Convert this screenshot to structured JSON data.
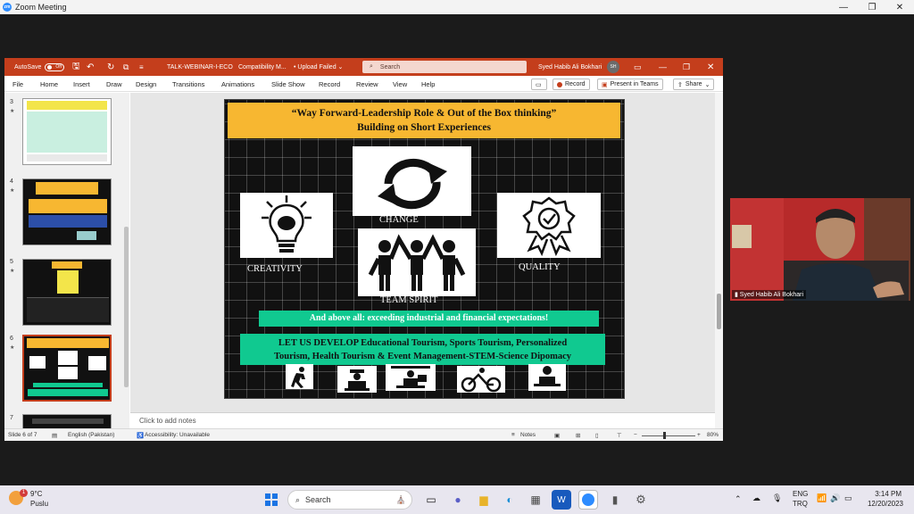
{
  "zoom": {
    "title": "Zoom Meeting"
  },
  "ppt": {
    "autosave": "AutoSave",
    "autosave_state": "Off",
    "doc_name": "TALK-WEBINAR-I-ECO",
    "mode": "Compatibility M...",
    "upload": "• Upload Failed ⌄",
    "search_placeholder": "Search",
    "user": "Syed Habib Ali Bokhari",
    "user_initials": "SH",
    "tabs": [
      "File",
      "Home",
      "Insert",
      "Draw",
      "Design",
      "Transitions",
      "Animations",
      "Slide Show",
      "Record",
      "Review",
      "View",
      "Help"
    ],
    "record_btn": "Record",
    "teams_btn": "Present in Teams",
    "share_btn": "Share",
    "thumb_numbers": [
      "3",
      "4",
      "5",
      "6",
      "7"
    ],
    "notes_placeholder": "Click to add notes",
    "status": {
      "slide": "Slide 6 of 7",
      "language": "English (Pakistan)",
      "accessibility": "Accessibility: Unavailable",
      "notes": "Notes",
      "zoom": "80%"
    }
  },
  "slide": {
    "title_line1": "“Way Forward-Leadership Role & Out of the Box thinking”",
    "title_line2": "Building on Short Experiences",
    "label_change": "CHANGE",
    "label_creativity": "CREATIVITY",
    "label_quality": "QUALITY",
    "label_team": "TEAM SPIRIT",
    "banner1": "And above all: exceeding industrial and financial expectations!",
    "banner2_line1": "LET US DEVELOP Educational Tourism, Sports Tourism, Personalized",
    "banner2_line2": "Tourism, Health Tourism & Event Management-STEM-Science Dipomacy"
  },
  "video": {
    "name": "Syed Habib Ali Bokhari"
  },
  "taskbar": {
    "weather_temp": "9°C",
    "weather_desc": "Puslu",
    "weather_badge": "1",
    "search": "Search",
    "lang1": "ENG",
    "lang2": "TRQ",
    "time": "3:14 PM",
    "date": "12/20/2023"
  }
}
